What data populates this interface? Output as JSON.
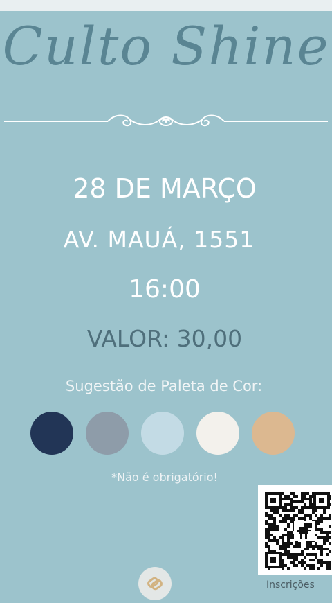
{
  "event": {
    "title": "Culto Shine",
    "date": "28 DE MARÇO",
    "address": "AV. MAUÁ, 1551",
    "time": "16:00",
    "price": "VALOR: 30,00"
  },
  "palette": {
    "title": "Sugestão de Paleta de Cor:",
    "colors": [
      "#223556",
      "#8e9ca9",
      "#c3dbe5",
      "#f3f1ec",
      "#dcb890"
    ],
    "note": "*Não é obrigatório!"
  },
  "qr": {
    "label": "Inscrições",
    "icon": "dinosaur-icon"
  },
  "footer": {
    "icon": "link-icon"
  },
  "colors": {
    "background": "#9cc3cc",
    "title": "#5a8593",
    "price": "#4f6f7b"
  }
}
